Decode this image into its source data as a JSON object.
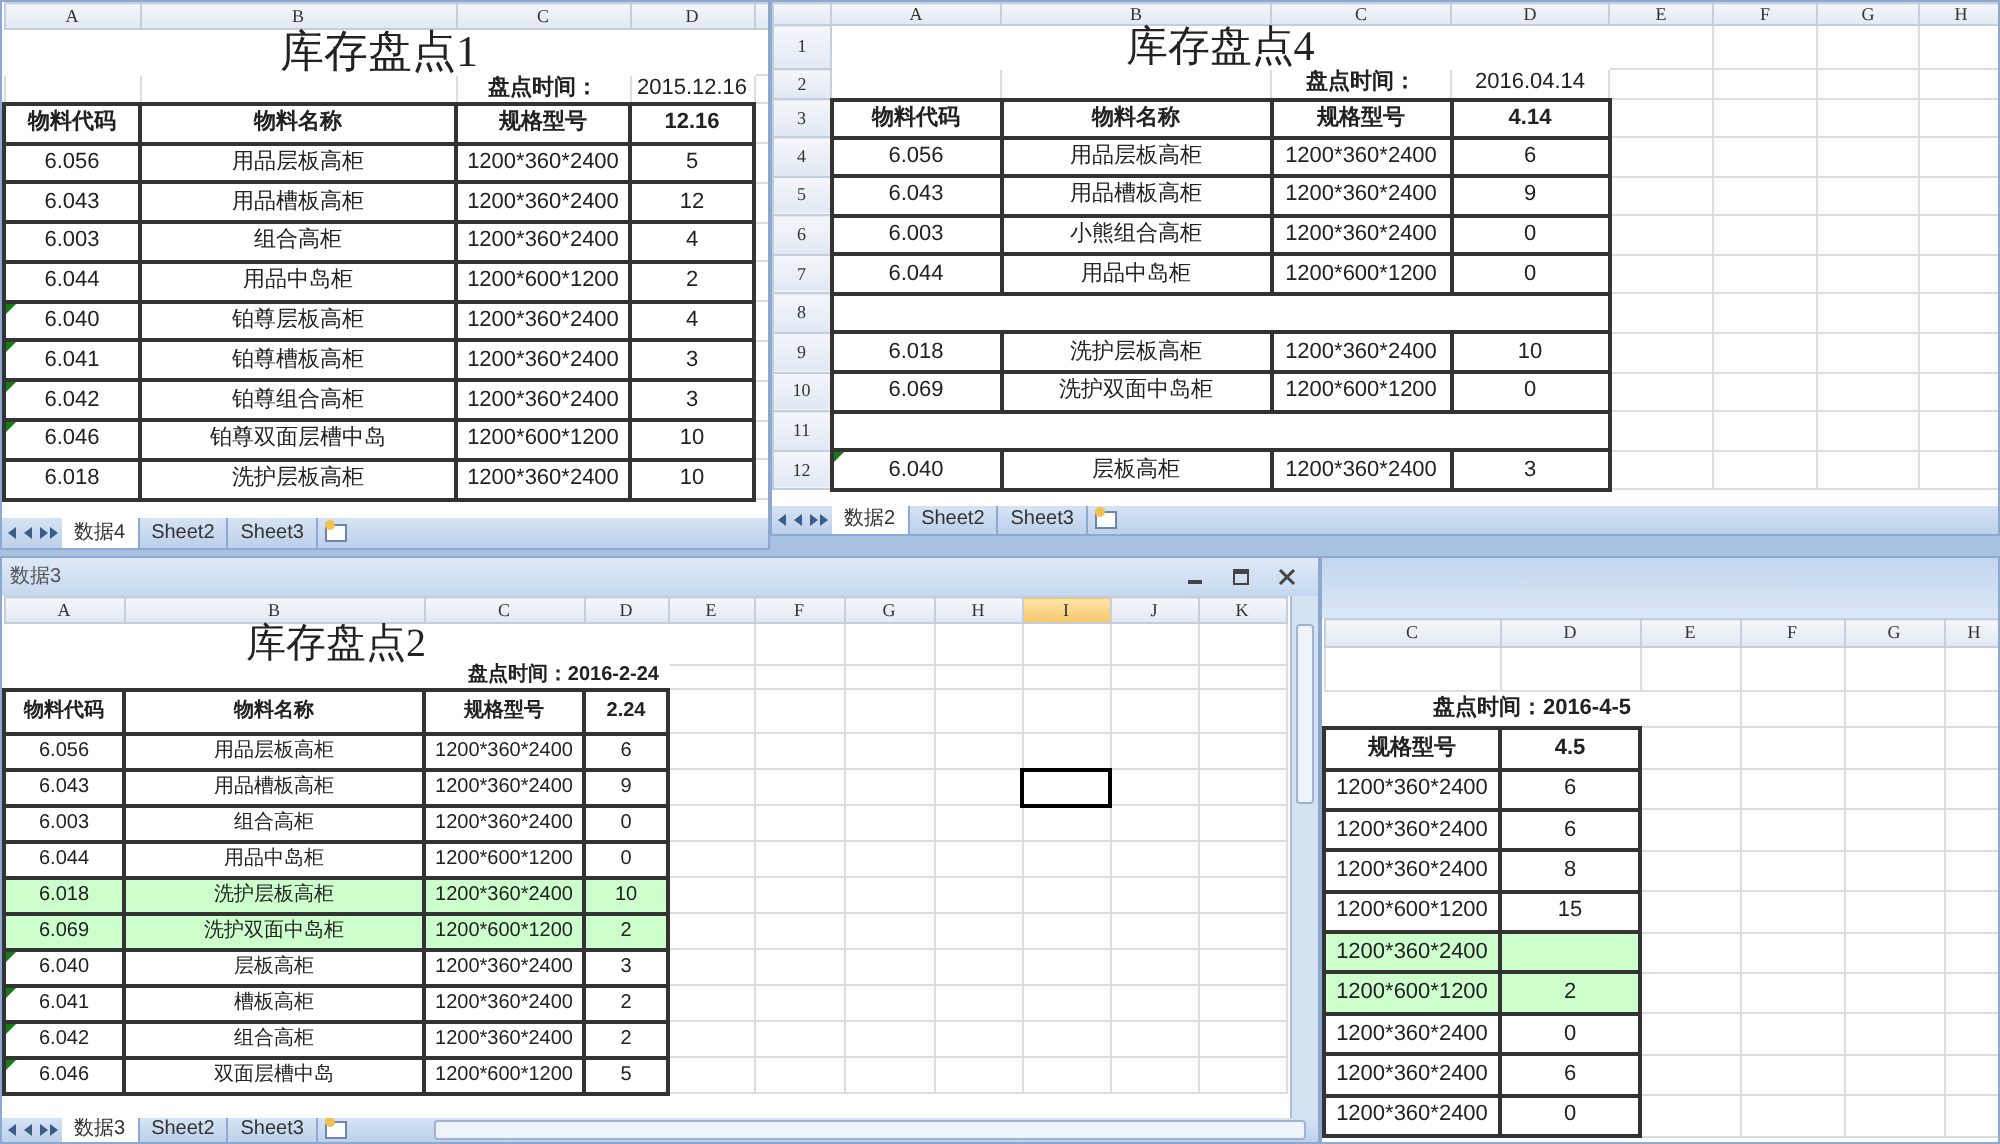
{
  "windows": [
    {
      "columns": [
        "A",
        "B",
        "C",
        "D"
      ],
      "heading": "库存盘点1",
      "date_label": "盘点时间：",
      "date_value": "2015.12.16",
      "headers": [
        "物料代码",
        "物料名称",
        "规格型号",
        "12.16"
      ],
      "rows": [
        {
          "cells": [
            "6.056",
            "用品层板高柜",
            "1200*360*2400",
            "5"
          ],
          "flagged": false
        },
        {
          "cells": [
            "6.043",
            "用品槽板高柜",
            "1200*360*2400",
            "12"
          ],
          "flagged": false
        },
        {
          "cells": [
            "6.003",
            "组合高柜",
            "1200*360*2400",
            "4"
          ],
          "flagged": false
        },
        {
          "cells": [
            "6.044",
            "用品中岛柜",
            "1200*600*1200",
            "2"
          ],
          "flagged": false
        },
        {
          "cells": [
            "6.040",
            "铂尊层板高柜",
            "1200*360*2400",
            "4"
          ],
          "flagged": true
        },
        {
          "cells": [
            "6.041",
            "铂尊槽板高柜",
            "1200*360*2400",
            "3"
          ],
          "flagged": true
        },
        {
          "cells": [
            "6.042",
            "铂尊组合高柜",
            "1200*360*2400",
            "3"
          ],
          "flagged": true
        },
        {
          "cells": [
            "6.046",
            "铂尊双面层槽中岛",
            "1200*600*1200",
            "10"
          ],
          "flagged": true
        },
        {
          "cells": [
            "6.018",
            "洗护层板高柜",
            "1200*360*2400",
            "10"
          ],
          "flagged": false
        }
      ],
      "sheet_tabs": [
        {
          "label": "数据4",
          "selected": true
        },
        {
          "label": "Sheet2",
          "selected": false
        },
        {
          "label": "Sheet3",
          "selected": false
        }
      ]
    },
    {
      "columns": [
        "A",
        "B",
        "C",
        "D",
        "E",
        "F",
        "G",
        "H"
      ],
      "row_numbers": [
        "1",
        "2",
        "3",
        "4",
        "5",
        "6",
        "7",
        "8",
        "9",
        "10",
        "11",
        "12"
      ],
      "heading": "库存盘点4",
      "date_label": "盘点时间：",
      "date_value": "2016.04.14",
      "headers": [
        "物料代码",
        "物料名称",
        "规格型号",
        "4.14"
      ],
      "rows": [
        {
          "kind": "data",
          "cells": [
            "6.056",
            "用品层板高柜",
            "1200*360*2400",
            "6"
          ],
          "flagged": false
        },
        {
          "kind": "data",
          "cells": [
            "6.043",
            "用品槽板高柜",
            "1200*360*2400",
            "9"
          ],
          "flagged": false
        },
        {
          "kind": "data",
          "cells": [
            "6.003",
            "小熊组合高柜",
            "1200*360*2400",
            "0"
          ],
          "flagged": false
        },
        {
          "kind": "data",
          "cells": [
            "6.044",
            "用品中岛柜",
            "1200*600*1200",
            "0"
          ],
          "flagged": false
        },
        {
          "kind": "blank"
        },
        {
          "kind": "data",
          "cells": [
            "6.018",
            "洗护层板高柜",
            "1200*360*2400",
            "10"
          ],
          "flagged": false
        },
        {
          "kind": "data",
          "cells": [
            "6.069",
            "洗护双面中岛柜",
            "1200*600*1200",
            "0"
          ],
          "flagged": false
        },
        {
          "kind": "blank"
        },
        {
          "kind": "data",
          "cells": [
            "6.040",
            "层板高柜",
            "1200*360*2400",
            "3"
          ],
          "flagged": true
        }
      ],
      "sheet_tabs": [
        {
          "label": "数据2",
          "selected": true
        },
        {
          "label": "Sheet2",
          "selected": false
        },
        {
          "label": "Sheet3",
          "selected": false
        }
      ]
    },
    {
      "title": "数据3",
      "columns": [
        {
          "label": "A",
          "selected": false
        },
        {
          "label": "B",
          "selected": false
        },
        {
          "label": "C",
          "selected": false
        },
        {
          "label": "D",
          "selected": false
        },
        {
          "label": "E",
          "selected": false
        },
        {
          "label": "F",
          "selected": false
        },
        {
          "label": "G",
          "selected": false
        },
        {
          "label": "H",
          "selected": false
        },
        {
          "label": "I",
          "selected": true
        },
        {
          "label": "J",
          "selected": false
        },
        {
          "label": "K",
          "selected": false
        }
      ],
      "heading": "库存盘点2",
      "date_text": "盘点时间：2016-2-24",
      "headers": [
        "物料代码",
        "物料名称",
        "规格型号",
        "2.24"
      ],
      "rows": [
        {
          "cells": [
            "6.056",
            "用品层板高柜",
            "1200*360*2400",
            "6"
          ],
          "highlighted": false,
          "selected": false,
          "flagged": false
        },
        {
          "cells": [
            "6.043",
            "用品槽板高柜",
            "1200*360*2400",
            "9"
          ],
          "highlighted": false,
          "selected": true,
          "flagged": false
        },
        {
          "cells": [
            "6.003",
            "组合高柜",
            "1200*360*2400",
            "0"
          ],
          "highlighted": false,
          "selected": false,
          "flagged": false
        },
        {
          "cells": [
            "6.044",
            "用品中岛柜",
            "1200*600*1200",
            "0"
          ],
          "highlighted": false,
          "selected": false,
          "flagged": false
        },
        {
          "cells": [
            "6.018",
            "洗护层板高柜",
            "1200*360*2400",
            "10"
          ],
          "highlighted": true,
          "selected": false,
          "flagged": false
        },
        {
          "cells": [
            "6.069",
            "洗护双面中岛柜",
            "1200*600*1200",
            "2"
          ],
          "highlighted": true,
          "selected": false,
          "flagged": false
        },
        {
          "cells": [
            "6.040",
            "层板高柜",
            "1200*360*2400",
            "3"
          ],
          "highlighted": false,
          "selected": false,
          "flagged": true
        },
        {
          "cells": [
            "6.041",
            "槽板高柜",
            "1200*360*2400",
            "2"
          ],
          "highlighted": false,
          "selected": false,
          "flagged": true
        },
        {
          "cells": [
            "6.042",
            "组合高柜",
            "1200*360*2400",
            "2"
          ],
          "highlighted": false,
          "selected": false,
          "flagged": true
        },
        {
          "cells": [
            "6.046",
            "双面层槽中岛",
            "1200*600*1200",
            "5"
          ],
          "highlighted": false,
          "selected": false,
          "flagged": true
        }
      ],
      "sheet_tabs": [
        {
          "label": "数据3",
          "selected": true
        },
        {
          "label": "Sheet2",
          "selected": false
        },
        {
          "label": "Sheet3",
          "selected": false
        }
      ]
    },
    {
      "columns": [
        "C",
        "D",
        "E",
        "F",
        "G",
        "H"
      ],
      "date_text": "盘点时间：2016-4-5",
      "headers": [
        "规格型号",
        "4.5"
      ],
      "rows": [
        {
          "cells": [
            "1200*360*2400",
            "6"
          ],
          "highlighted": false
        },
        {
          "cells": [
            "1200*360*2400",
            "6"
          ],
          "highlighted": false
        },
        {
          "cells": [
            "1200*360*2400",
            "8"
          ],
          "highlighted": false
        },
        {
          "cells": [
            "1200*600*1200",
            "15"
          ],
          "highlighted": false
        },
        {
          "cells": [
            "1200*360*2400"
          ],
          "highlighted": true
        },
        {
          "cells": [
            "1200*600*1200",
            "2"
          ],
          "highlighted": true
        },
        {
          "cells": [
            "1200*360*2400",
            "0"
          ],
          "highlighted": false
        },
        {
          "cells": [
            "1200*360*2400",
            "6"
          ],
          "highlighted": false
        },
        {
          "cells": [
            "1200*360*2400",
            "0"
          ],
          "highlighted": false
        }
      ]
    }
  ]
}
